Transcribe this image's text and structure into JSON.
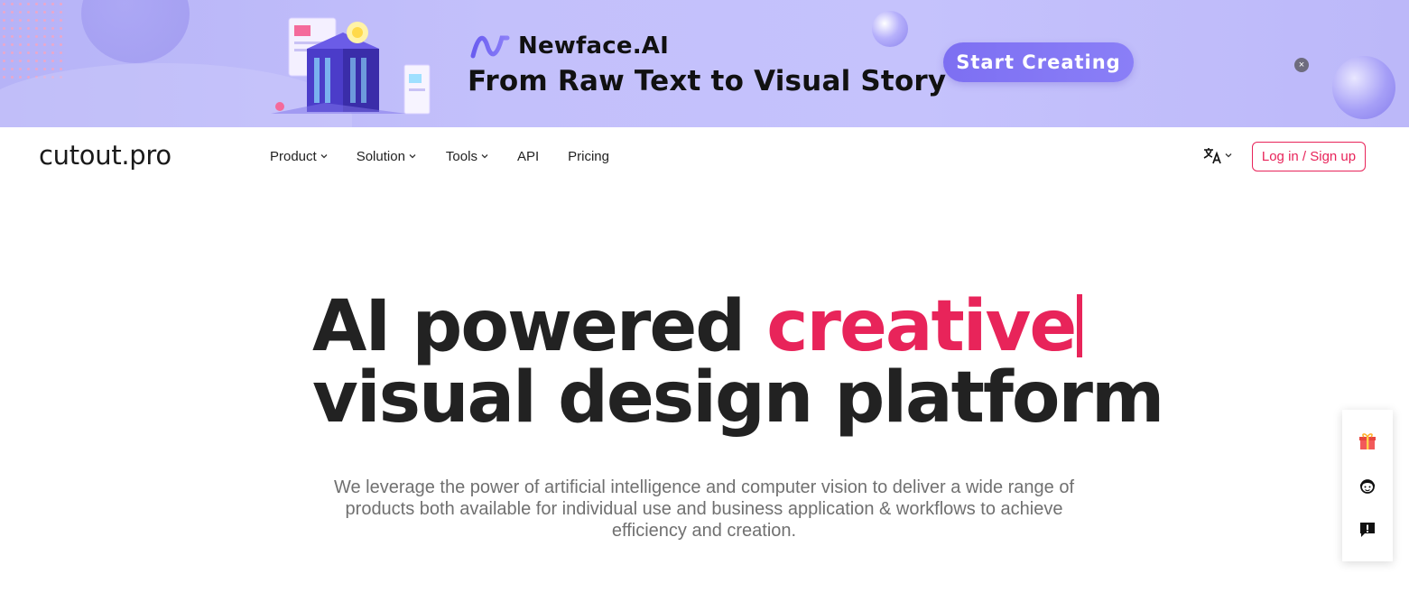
{
  "banner": {
    "brand_name": "Newface.AI",
    "tagline": "From Raw Text to Visual Story",
    "cta_label": "Start Creating",
    "close_glyph": "×",
    "colors": {
      "background": "#c1befb",
      "cta": "#7d6ff2"
    }
  },
  "nav": {
    "logo_text": "cutout.pro",
    "items": [
      {
        "label": "Product",
        "has_dropdown": true
      },
      {
        "label": "Solution",
        "has_dropdown": true
      },
      {
        "label": "Tools",
        "has_dropdown": true
      },
      {
        "label": "API",
        "has_dropdown": false
      },
      {
        "label": "Pricing",
        "has_dropdown": false
      }
    ],
    "language_icon": "translate-icon",
    "login_label": "Log in / Sign up",
    "accent_color": "#e8245a"
  },
  "hero": {
    "line1_prefix": "AI powered ",
    "line1_accent": "creative",
    "line2": "visual design platform",
    "subtitle": "We leverage the power of artificial intelligence and computer vision to deliver a wide range of products both available for individual use and business application & workflows to achieve efficiency and creation."
  },
  "side_widget": {
    "icons": [
      "gift-icon",
      "support-agent-icon",
      "feedback-icon"
    ]
  }
}
